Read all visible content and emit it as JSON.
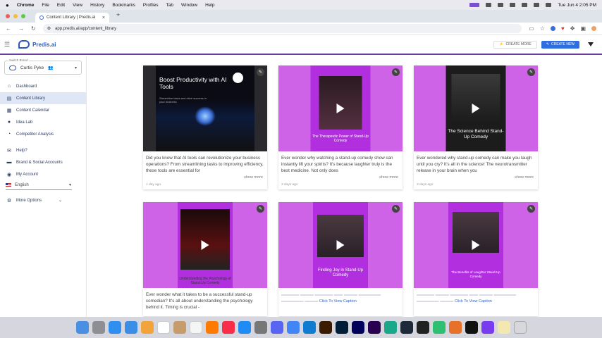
{
  "menubar": {
    "items": [
      "Chrome",
      "File",
      "Edit",
      "View",
      "History",
      "Bookmarks",
      "Profiles",
      "Tab",
      "Window",
      "Help"
    ],
    "clock": "Tue Jun 4  2:05 PM"
  },
  "browser": {
    "tab_title": "Content Library | Predis.ai",
    "url": "app.predis.ai/app/content_library"
  },
  "header": {
    "brand_name": "Predis.ai",
    "create_more": "CREATE MORE",
    "create_new": "CREATE NEW"
  },
  "sidebar": {
    "switch_brand_label": "Switch Brand",
    "brand_value": "Curtis Pyke",
    "items": [
      {
        "label": "Dashboard",
        "icon": "home-icon"
      },
      {
        "label": "Content Library",
        "icon": "library-icon"
      },
      {
        "label": "Content Calendar",
        "icon": "calendar-icon"
      },
      {
        "label": "Idea Lab",
        "icon": "bulb-icon"
      },
      {
        "label": "Competitor Analysis",
        "icon": "chart-icon"
      }
    ],
    "items2": [
      {
        "label": "Help?",
        "icon": "help-icon"
      },
      {
        "label": "Brand & Social Accounts",
        "icon": "briefcase-icon"
      },
      {
        "label": "My Account",
        "icon": "account-icon"
      }
    ],
    "language": "English",
    "more_options": "More Options"
  },
  "cards": [
    {
      "thumb_title": "Boost Productivity with AI Tools",
      "thumb_sub": "Streamline tasks and drive success in your business",
      "text": "Did you know that AI tools can revolutionize your business operations? From streamlining tasks to improving efficiency, these tools are essential for",
      "show_more": "show more",
      "age": "1 day ago"
    },
    {
      "thumb_title": "The Therapeutic Power of Stand-Up Comedy",
      "text": "Ever wonder why watching a stand-up comedy show can instantly lift your spirits? It's because laughter truly is the best medicine. Not only does",
      "show_more": "show more",
      "age": "3 days ago"
    },
    {
      "thumb_title": "The Science Behind Stand-Up Comedy",
      "text": "Ever wondered why stand-up comedy can make you laugh until you cry? It's all in the science! The neurotransmitter release in your brain when you",
      "show_more": "show more",
      "age": "3 days ago"
    },
    {
      "thumb_title": "Understanding the Psychology of Stand-Up Comedy",
      "text": "Ever wonder what it takes to be a successful stand-up comedian? It's all about understanding the psychology behind it. Timing is crucial -"
    },
    {
      "thumb_title": "Finding Joy in Stand-Up Comedy",
      "caption_link": "Click To View Caption"
    },
    {
      "thumb_title": "The Benefits of Laughter Stand-Up Comedy",
      "caption_link": "Click To View Caption"
    }
  ],
  "colors": {
    "accent": "#2d6ee0",
    "brand_purple": "#b22fe0",
    "header_rule": "#6b3fa0"
  }
}
